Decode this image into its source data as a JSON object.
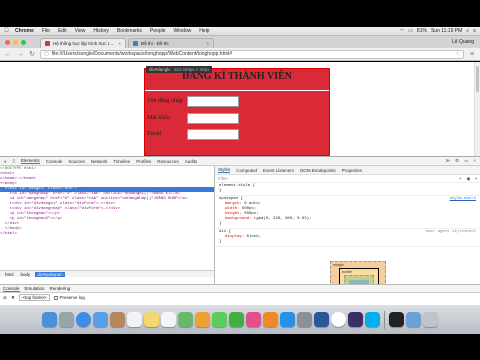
{
  "menubar": {
    "app": "Chrome",
    "items": [
      "File",
      "Edit",
      "View",
      "History",
      "Bookmarks",
      "People",
      "Window",
      "Help"
    ],
    "battery": "81%",
    "clock": "Sun 11:19 PM",
    "user": "Lê Quang"
  },
  "tabs": [
    {
      "title": "Hệ thống học lập trình trực t…"
    },
    {
      "title": "Đề thi - Đề thi"
    }
  ],
  "address": {
    "url": "file:///Users/songle/Documents/workspace/tonghopp/WebContent/tonghopp.html#"
  },
  "page": {
    "tooltip": {
      "tag": "div#dangki",
      "size": "333.328px × 40px"
    },
    "heading": "ĐĂNG KÍ THÀNH VIÊN",
    "fields": [
      {
        "label": "Tên đăng nhập"
      },
      {
        "label": "Mật khẩu"
      },
      {
        "label": "Email"
      }
    ]
  },
  "devtools": {
    "tabs": [
      "Elements",
      "Console",
      "Sources",
      "Network",
      "Timeline",
      "Profiles",
      "Resources",
      "Audits"
    ],
    "active_tab": "Elements",
    "dom_lines": [
      {
        "text": "<!DOCTYPE html>",
        "type": "comment"
      },
      {
        "text": "<html>",
        "type": "tag"
      },
      {
        "text": "▸<head>…</head>",
        "type": "tag"
      },
      {
        "text": "▾<body>",
        "type": "tag"
      },
      {
        "text": "  ▾<div id=\"dangki\" class=\"box\">",
        "type": "selected"
      },
      {
        "text": "    ▸<a id=\"dangnhap\" href=\"#\" class=\"tab\" onclick=\"onDangKi()\">ĐĂNG KÍ</a>",
        "type": "tag"
      },
      {
        "text": "    <a id=\"dangnhap\" href=\"#\" class=\"tab\" onclick=\"onDangNhap()\">ĐĂNG NHẬP</a>",
        "type": "tag"
      },
      {
        "text": "    ▸<div id=\"divdangki\" class=\"divForm\">…</div>",
        "type": "tag"
      },
      {
        "text": "    ▸<div id=\"divdangnhap\" class=\"divForm\">…</div>",
        "type": "tag"
      },
      {
        "text": "    <p id=\"thongbao\"></p>",
        "type": "tag"
      },
      {
        "text": "    <p id=\"thongbao2\"></p>",
        "type": "tag"
      },
      {
        "text": "  </div>",
        "type": "tag"
      },
      {
        "text": "  </body>",
        "type": "tag"
      },
      {
        "text": "</html>",
        "type": "tag"
      }
    ],
    "style_tabs": [
      "Styles",
      "Computed",
      "Event Listeners",
      "DOM Breakpoints",
      "Properties"
    ],
    "filter_placeholder": "Filter",
    "rules": [
      {
        "selector": "element.style {",
        "source": "",
        "props": [],
        "close": "}"
      },
      {
        "selector": "#pokepen {",
        "source": "style.css:1",
        "props": [
          {
            "p": "margin",
            "v": "0 auto;"
          },
          {
            "p": "width",
            "v": "500px;"
          },
          {
            "p": "height",
            "v": "500px;"
          },
          {
            "p": "background",
            "v": "rgba(0, 220, 300, 0.03);"
          }
        ],
        "close": "}"
      },
      {
        "selector": "div {",
        "source": "user agent stylesheet",
        "props": [
          {
            "p": "display",
            "v": "block;"
          }
        ],
        "close": "}"
      }
    ],
    "boxmodel": {
      "margin_label": "margin",
      "border_label": "border",
      "padding_label": "padding"
    },
    "breadcrumbs": [
      "html",
      "body",
      "div#pokepen"
    ],
    "drawer_tabs": [
      "Console",
      "Emulation",
      "Rendering"
    ],
    "frame_select": "<top frame>",
    "preserve_log": "Preserve log"
  },
  "dock": {
    "icons": [
      "finder-icon",
      "launchpad-icon",
      "safari-icon",
      "mail-icon",
      "contacts-icon",
      "calendar-icon",
      "notes-icon",
      "reminders-icon",
      "maps-icon",
      "photos-icon",
      "messages-icon",
      "facetime-icon",
      "itunes-icon",
      "ibooks-icon",
      "appstore-icon",
      "preferences-icon",
      "word-icon",
      "chrome-icon",
      "eclipse-icon",
      "skype-icon",
      "terminal-icon",
      "downloads-icon",
      "trash-icon"
    ],
    "colors": [
      "#4a90d9",
      "#9aa4ae",
      "#3a8ee6",
      "#5aa0e8",
      "#b8865b",
      "#f2f2f2",
      "#f5d76e",
      "#f4f4f4",
      "#67b86a",
      "#f0a030",
      "#5ccd5c",
      "#40b040",
      "#e0508a",
      "#f08a24",
      "#2a90e6",
      "#8a8f98",
      "#2b5797",
      "#ffffff",
      "#3b2f67",
      "#00aff0",
      "#222222",
      "#6aa0d8",
      "#c0c4ca"
    ]
  }
}
